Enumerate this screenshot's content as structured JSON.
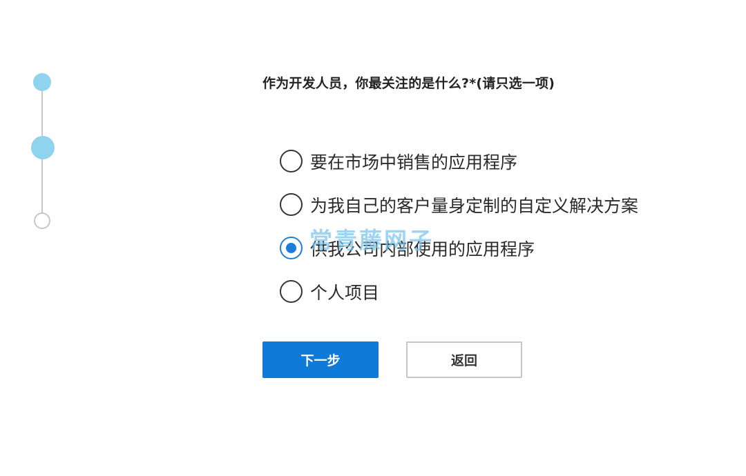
{
  "question": {
    "text": "作为开发人员，你最关注的是什么?*(请只选一项)"
  },
  "options": [
    {
      "label": "要在市场中销售的应用程序",
      "selected": false
    },
    {
      "label": "为我自己的客户量身定制的自定义解决方案",
      "selected": false
    },
    {
      "label": "供我公司内部使用的应用程序",
      "selected": true
    },
    {
      "label": "个人项目",
      "selected": false
    }
  ],
  "buttons": {
    "next_label": "下一步",
    "back_label": "返回"
  },
  "watermark": "常青藤网子",
  "colors": {
    "accent": "#0f7ad8",
    "step_active": "#8fd3ee",
    "step_inactive": "#c6c6c6"
  }
}
